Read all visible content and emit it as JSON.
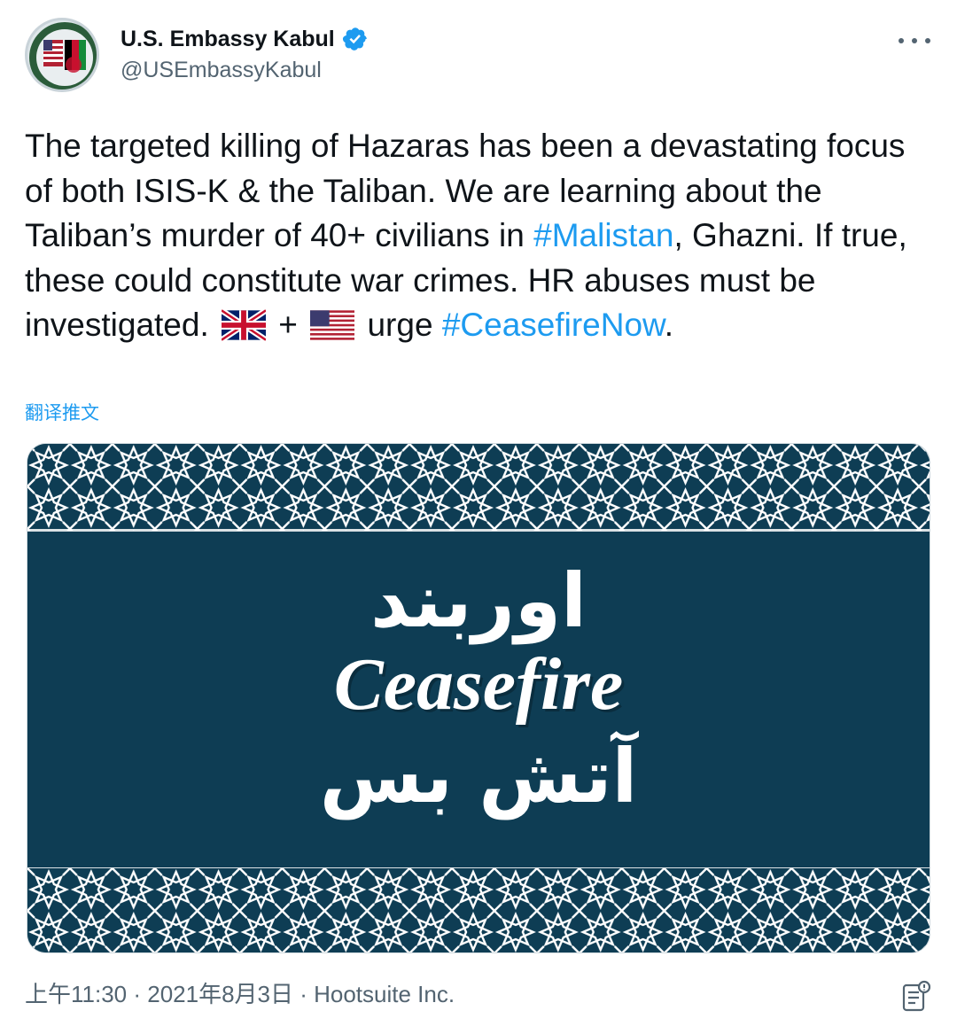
{
  "account": {
    "display_name": "U.S. Embassy Kabul",
    "handle": "@USEmbassyKabul",
    "verified_icon": "verified-badge-icon",
    "more_icon": "more-options-icon"
  },
  "tweet": {
    "text_part1": "The targeted killing of Hazaras has been a devastating focus of both ISIS-K & the Taliban. We are learning about the Taliban’s murder of 40+ civilians in ",
    "hashtag1": "#Malistan",
    "text_part2": ", Ghazni.  If true, these could constitute war crimes. HR abuses must be investigated. ",
    "flag1": "uk-flag-icon",
    "plus": " + ",
    "flag2": "us-flag-icon",
    "text_part3": " urge ",
    "hashtag2": "#CeasefireNow",
    "text_part4": ".",
    "translate_label": "翻译推文"
  },
  "media": {
    "line_persian": "اوربند",
    "line_english": "Ceasefire",
    "line_pashto": "آتش بس",
    "colors": {
      "background": "#0e3d54",
      "pattern": "#ffffff"
    }
  },
  "footer": {
    "meta": "上午11:30 · 2021年8月3日 · Hootsuite Inc.",
    "note_icon": "tweet-analytics-note-icon"
  },
  "colors": {
    "link": "#1d9bf0",
    "secondary_text": "#536471"
  }
}
